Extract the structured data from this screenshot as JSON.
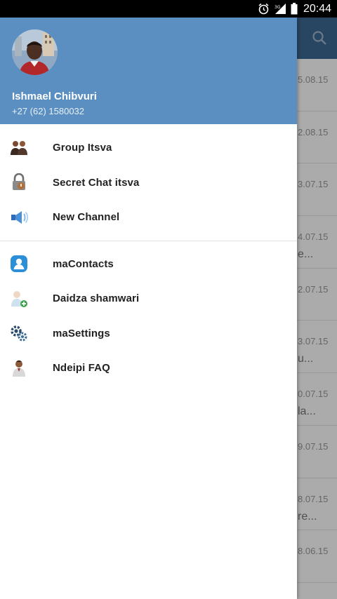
{
  "status_bar": {
    "time": "20:44",
    "icons": [
      "alarm-icon",
      "signal-icon",
      "battery-icon"
    ]
  },
  "background_chats": {
    "rows": [
      {
        "date": "5.08.15",
        "snippet": ""
      },
      {
        "date": "2.08.15",
        "snippet": ""
      },
      {
        "date": "3.07.15",
        "snippet": ""
      },
      {
        "date": "4.07.15",
        "snippet": "e..."
      },
      {
        "date": "2.07.15",
        "snippet": ""
      },
      {
        "date": "3.07.15",
        "snippet": "u..."
      },
      {
        "date": "0.07.15",
        "snippet": "la..."
      },
      {
        "date": "9.07.15",
        "snippet": ""
      },
      {
        "date": "8.07.15",
        "snippet": "re..."
      },
      {
        "date": "8.06.15",
        "snippet": ""
      }
    ]
  },
  "drawer": {
    "user": {
      "name": "Ishmael Chibvuri",
      "phone": "+27 (62) 1580032"
    },
    "menu_group_1": [
      {
        "label": "Group Itsva",
        "icon": "group-icon"
      },
      {
        "label": "Secret Chat itsva",
        "icon": "lock-icon"
      },
      {
        "label": "New Channel",
        "icon": "megaphone-icon"
      }
    ],
    "menu_group_2": [
      {
        "label": "maContacts",
        "icon": "contacts-icon"
      },
      {
        "label": "Daidza shamwari",
        "icon": "invite-friend-icon"
      },
      {
        "label": "maSettings",
        "icon": "settings-icon"
      },
      {
        "label": "Ndeipi FAQ",
        "icon": "faq-icon"
      }
    ]
  },
  "colors": {
    "drawer_header": "#5b8fc1",
    "app_header": "#3d6791"
  }
}
